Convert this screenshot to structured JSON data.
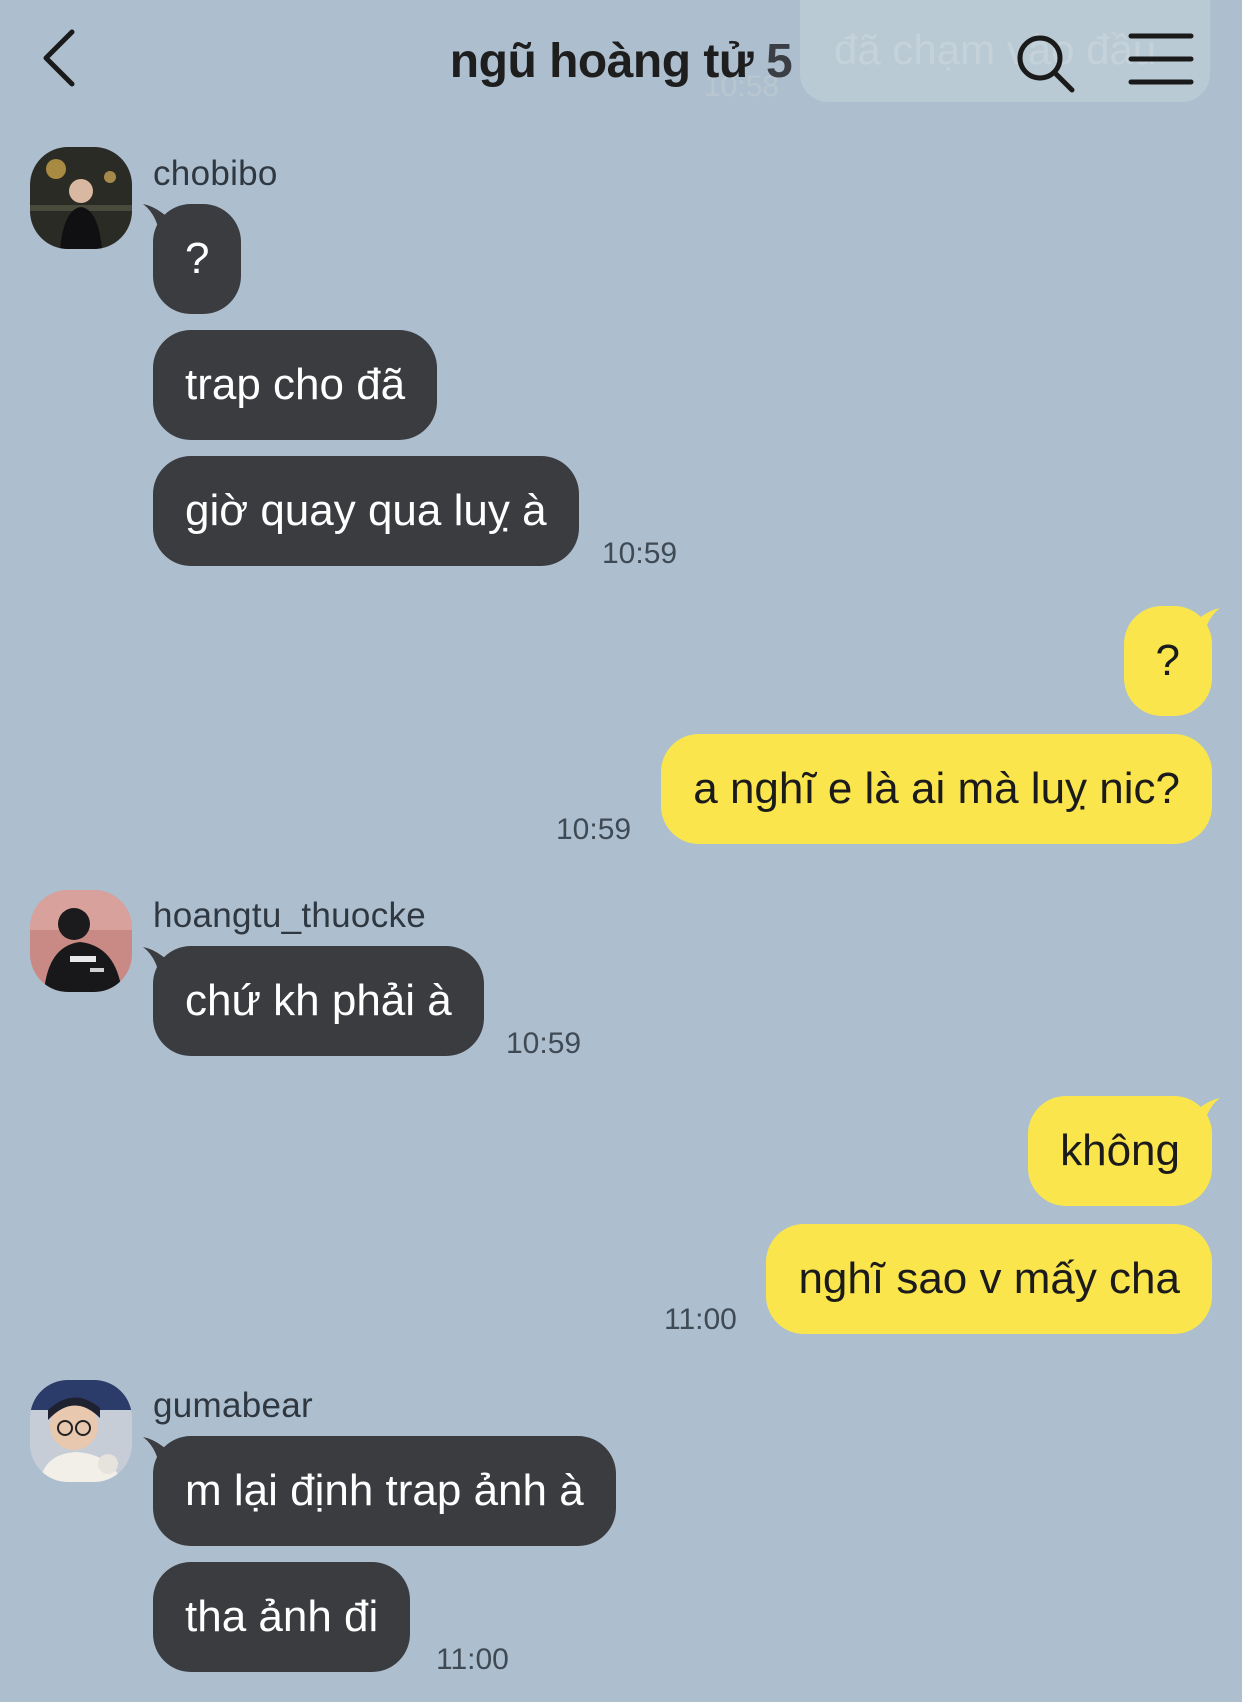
{
  "header": {
    "title": "ngũ hoàng tử",
    "member_count": "5",
    "ghost_preview": "đã chạm vào đầu",
    "ghost_time": "10:58",
    "icons": {
      "back": "chevron-left-icon",
      "search": "search-icon",
      "menu": "hamburger-menu-icon"
    }
  },
  "colors": {
    "background": "#adbfcf",
    "incoming_bubble": "#3b3c40",
    "outgoing_bubble": "#fae54c"
  },
  "messages": [
    {
      "sender": "chobibo",
      "direction": "incoming",
      "bubbles": [
        "?",
        "trap cho đã",
        "giờ quay qua luỵ à"
      ],
      "time": "10:59"
    },
    {
      "sender": "me",
      "direction": "outgoing",
      "bubbles": [
        "?",
        "a nghĩ e là ai mà luỵ nic?"
      ],
      "time": "10:59"
    },
    {
      "sender": "hoangtu_thuocke",
      "direction": "incoming",
      "bubbles": [
        "chứ kh phải à"
      ],
      "time": "10:59"
    },
    {
      "sender": "me",
      "direction": "outgoing",
      "bubbles": [
        "không",
        "nghĩ sao v mấy cha"
      ],
      "time": "11:00"
    },
    {
      "sender": "gumabear",
      "direction": "incoming",
      "bubbles": [
        "m lại định trap ảnh à",
        "tha ảnh đi"
      ],
      "time": "11:00"
    }
  ]
}
